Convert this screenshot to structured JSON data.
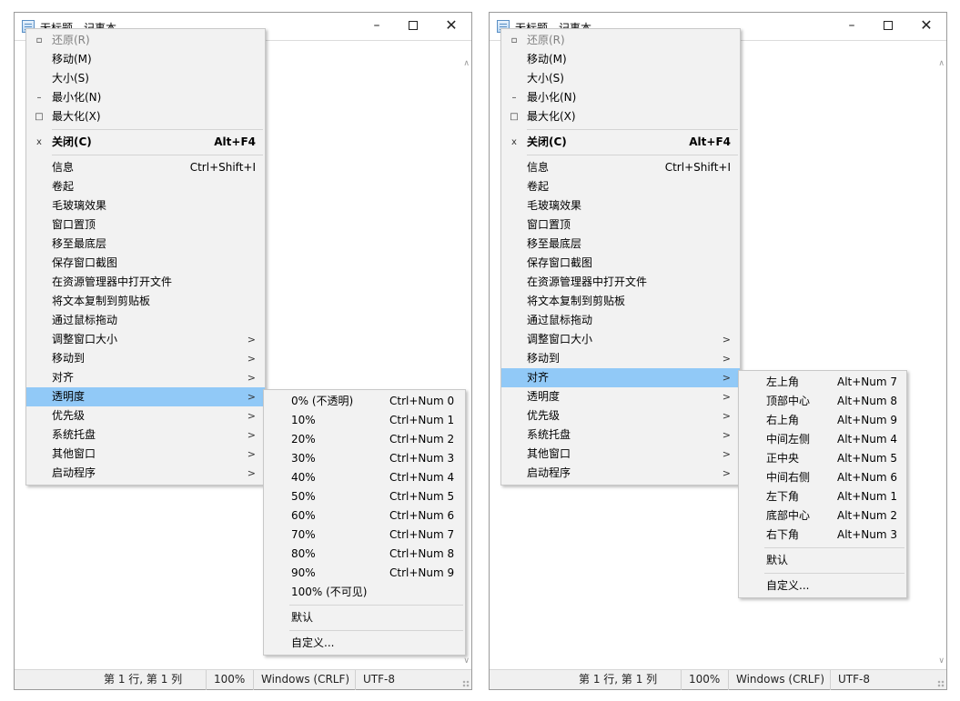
{
  "window": {
    "title": "无标题 - 记事本",
    "minimize_glyph": "–",
    "close_glyph": "✕"
  },
  "statusbar": {
    "position": "第 1 行, 第 1 列",
    "zoom": "100%",
    "line_ending": "Windows (CRLF)",
    "encoding": "UTF-8"
  },
  "menu": {
    "restore": {
      "label": "还原(R)",
      "icon": "restore-icon"
    },
    "move": {
      "label": "移动(M)"
    },
    "size": {
      "label": "大小(S)"
    },
    "minimize": {
      "label": "最小化(N)",
      "icon": "minimize-icon",
      "glyph": "–"
    },
    "maximize": {
      "label": "最大化(X)",
      "icon": "maximize-icon",
      "glyph": "□"
    },
    "close": {
      "label": "关闭(C)",
      "shortcut": "Alt+F4",
      "icon": "close-icon",
      "glyph": "x"
    },
    "info": {
      "label": "信息",
      "shortcut": "Ctrl+Shift+I"
    },
    "rollup": {
      "label": "卷起"
    },
    "frosted_glass": {
      "label": "毛玻璃效果"
    },
    "always_on_top": {
      "label": "窗口置顶"
    },
    "send_to_bottom": {
      "label": "移至最底层"
    },
    "save_screenshot": {
      "label": "保存窗口截图"
    },
    "open_in_explorer": {
      "label": "在资源管理器中打开文件"
    },
    "copy_text": {
      "label": "将文本复制到剪贴板"
    },
    "drag_by_mouse": {
      "label": "通过鼠标拖动"
    },
    "resize_window": {
      "label": "调整窗口大小"
    },
    "move_to": {
      "label": "移动到"
    },
    "align": {
      "label": "对齐"
    },
    "transparency": {
      "label": "透明度"
    },
    "priority": {
      "label": "优先级"
    },
    "system_tray": {
      "label": "系统托盘"
    },
    "other_windows": {
      "label": "其他窗口"
    },
    "launch_program": {
      "label": "启动程序"
    },
    "submenu_arrow": ">"
  },
  "transparency_submenu": {
    "items": [
      {
        "label": "0% (不透明)",
        "shortcut": "Ctrl+Num 0"
      },
      {
        "label": "10%",
        "shortcut": "Ctrl+Num 1"
      },
      {
        "label": "20%",
        "shortcut": "Ctrl+Num 2"
      },
      {
        "label": "30%",
        "shortcut": "Ctrl+Num 3"
      },
      {
        "label": "40%",
        "shortcut": "Ctrl+Num 4"
      },
      {
        "label": "50%",
        "shortcut": "Ctrl+Num 5"
      },
      {
        "label": "60%",
        "shortcut": "Ctrl+Num 6"
      },
      {
        "label": "70%",
        "shortcut": "Ctrl+Num 7"
      },
      {
        "label": "80%",
        "shortcut": "Ctrl+Num 8"
      },
      {
        "label": "90%",
        "shortcut": "Ctrl+Num 9"
      },
      {
        "label": "100% (不可见)",
        "shortcut": ""
      }
    ],
    "default": "默认",
    "custom": "自定义..."
  },
  "align_submenu": {
    "items": [
      {
        "label": "左上角",
        "shortcut": "Alt+Num 7"
      },
      {
        "label": "顶部中心",
        "shortcut": "Alt+Num 8"
      },
      {
        "label": "右上角",
        "shortcut": "Alt+Num 9"
      },
      {
        "label": "中间左侧",
        "shortcut": "Alt+Num 4"
      },
      {
        "label": "正中央",
        "shortcut": "Alt+Num 5"
      },
      {
        "label": "中间右侧",
        "shortcut": "Alt+Num 6"
      },
      {
        "label": "左下角",
        "shortcut": "Alt+Num 1"
      },
      {
        "label": "底部中心",
        "shortcut": "Alt+Num 2"
      },
      {
        "label": "右下角",
        "shortcut": "Alt+Num 3"
      }
    ],
    "default": "默认",
    "custom": "自定义..."
  },
  "colors": {
    "menu_background": "#f2f2f2",
    "highlight": "#91c9f7",
    "statusbar_background": "#f0f0f0"
  }
}
